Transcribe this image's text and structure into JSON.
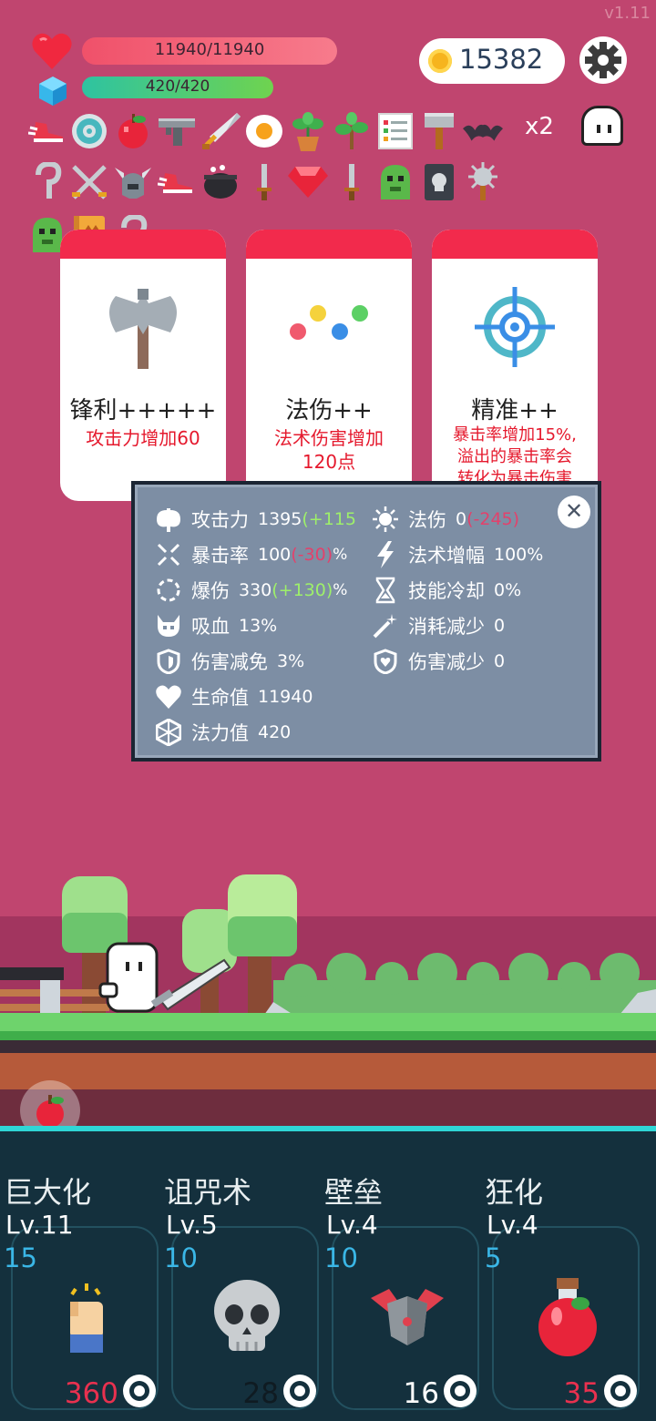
{
  "version": "v1.11",
  "hud": {
    "hp_text": "11940/11940",
    "hp_fraction": 1.0,
    "mp_text": "420/420",
    "mp_fraction": 1.0,
    "coins": "15382",
    "multiplier": "x2"
  },
  "items_row1": [
    "winged-boot-icon",
    "target-disc-icon",
    "apple-icon",
    "pistol-icon",
    "sword-icon",
    "fried-egg-icon",
    "potted-plant-icon",
    "sapling-icon",
    "checklist-icon",
    "hammer-icon",
    "bat-icon"
  ],
  "items_row2": [
    "hook-icon",
    "crossed-swords-icon",
    "horned-helmet-icon",
    "winged-boot-icon",
    "cauldron-icon",
    "dagger-icon",
    "ruby-icon",
    "dagger-icon",
    "green-slime-icon",
    "skull-tome-icon",
    "spiked-mace-icon"
  ],
  "items_row3": [
    "green-slime-icon",
    "crown-book-icon",
    "hook-icon"
  ],
  "cards": [
    {
      "title": "锋利+++++",
      "desc": "攻击力增加60",
      "icon": "battle-axe-icon"
    },
    {
      "title": "法伤++",
      "desc_lines": [
        "法术伤害增加",
        "120点"
      ],
      "icon": "magic-orbs-icon"
    },
    {
      "title": "精准++",
      "desc_lines": [
        "暴击率增加15%,",
        "溢出的暴击率会",
        "转化为暴击伤害"
      ],
      "icon": "crosshair-icon"
    }
  ],
  "stats": {
    "attack": {
      "label": "攻击力",
      "value": "1395",
      "delta": "(+115"
    },
    "crit_rate": {
      "label": "暴击率",
      "value": "100",
      "delta": "(-30)",
      "unit": "%"
    },
    "crit_damage": {
      "label": "爆伤",
      "value": "330",
      "delta": "(+130)",
      "unit": "%"
    },
    "lifesteal": {
      "label": "吸血",
      "value": "13%"
    },
    "damage_immunity": {
      "label": "伤害减免",
      "value": "3%"
    },
    "health": {
      "label": "生命值",
      "value": "11940"
    },
    "mana": {
      "label": "法力值",
      "value": "420"
    },
    "magic_damage": {
      "label": "法伤",
      "value": "0",
      "delta": "(-245)"
    },
    "spell_amp": {
      "label": "法术增幅",
      "value": "100%"
    },
    "cooldown": {
      "label": "技能冷却",
      "value": "0%"
    },
    "cost_reduction": {
      "label": "消耗减少",
      "value": "0"
    },
    "damage_reduction": {
      "label": "伤害减少",
      "value": "0"
    },
    "close_glyph": "✕"
  },
  "skills": [
    {
      "name": "巨大化",
      "level": "Lv.11",
      "cost": "15",
      "count": "360",
      "count_color": "#e8314f",
      "icon": "raised-fist-icon"
    },
    {
      "name": "诅咒术",
      "level": "Lv.5",
      "cost": "10",
      "count": "28",
      "count_color": "#0f1b22",
      "icon": "skull-icon"
    },
    {
      "name": "壁垒",
      "level": "Lv.4",
      "cost": "10",
      "count": "16",
      "count_color": "#ffffff",
      "icon": "shield-armor-icon"
    },
    {
      "name": "狂化",
      "level": "Lv.4",
      "cost": "5",
      "count": "35",
      "count_color": "#e8314f",
      "icon": "red-potion-icon"
    }
  ]
}
